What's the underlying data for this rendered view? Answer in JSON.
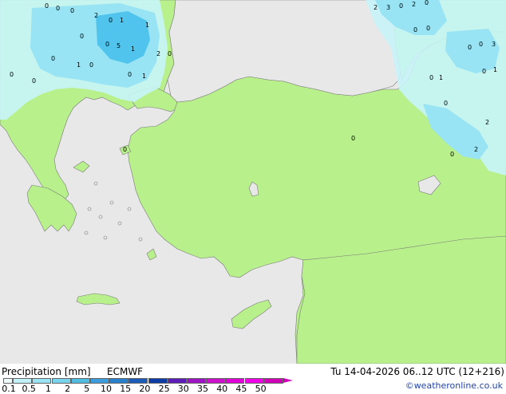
{
  "legend": {
    "title": "Precipitation [mm]",
    "model": "ECMWF",
    "valid_time": "Tu 14-04-2026 06..12 UTC (12+216)",
    "credit": "©weatheronline.co.uk",
    "ticks": [
      "0.1",
      "0.5",
      "1",
      "2",
      "5",
      "10",
      "15",
      "20",
      "25",
      "30",
      "35",
      "40",
      "45",
      "50"
    ],
    "colors": [
      "#f0fcfc",
      "#c0f0f8",
      "#98e4f4",
      "#78d4ec",
      "#50bce0",
      "#3c9cdc",
      "#2880cc",
      "#1c5cb8",
      "#0c3ca4",
      "#5c1cb8",
      "#9c14c4",
      "#cc10cc",
      "#e000d8",
      "#f000e8",
      "#d000b8"
    ]
  },
  "map_colors": {
    "sea": "#e8e8e8",
    "land": "#b8f08c",
    "light_precip": "#c8f4f8",
    "medium_precip": "#98e4f4",
    "heavy_precip": "#50c4ec"
  },
  "precip_labels": [
    "0",
    "0",
    "0",
    "2",
    "0",
    "1",
    "1",
    "0",
    "0",
    "0",
    "5",
    "1",
    "0",
    "1",
    "0",
    "2",
    "0",
    "1",
    "0",
    "0",
    "2",
    "3",
    "0",
    "2",
    "0",
    "0",
    "0",
    "0",
    "0",
    "3",
    "0",
    "1",
    "0",
    "1",
    "0",
    "2",
    "2",
    "0",
    "0",
    "0"
  ]
}
